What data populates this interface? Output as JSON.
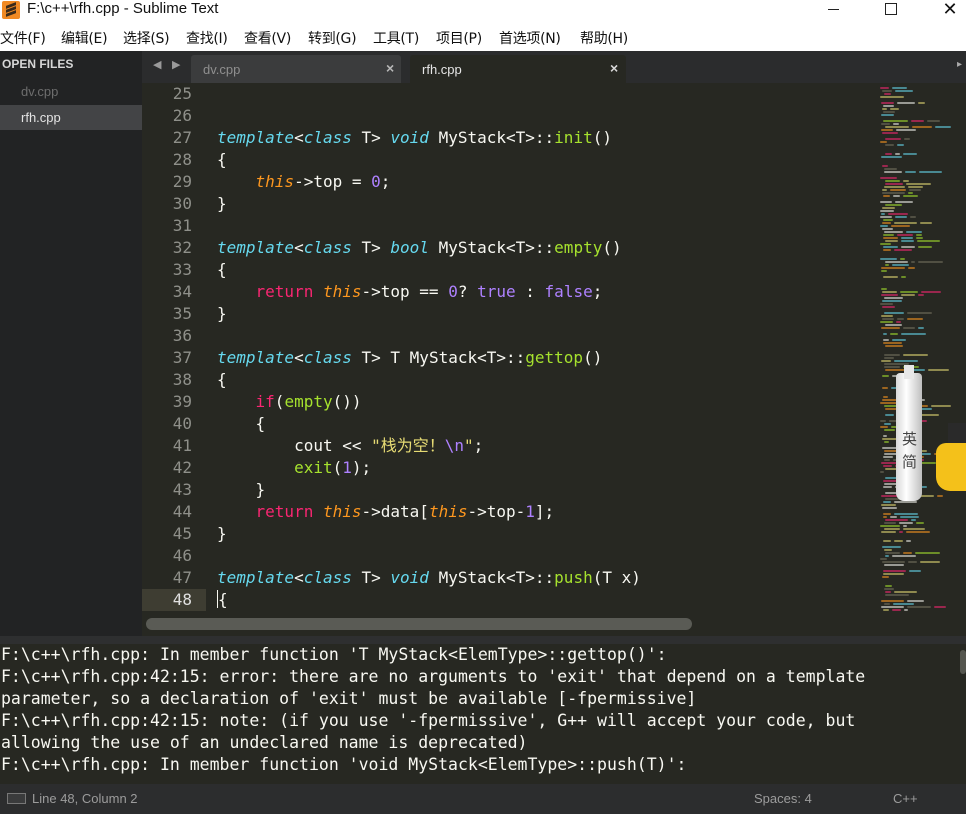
{
  "window": {
    "title": "F:\\c++\\rfh.cpp - Sublime Text",
    "icon": "sublime-text-icon"
  },
  "menu": [
    "文件(F)",
    "编辑(E)",
    "选择(S)",
    "查找(I)",
    "查看(V)",
    "转到(G)",
    "工具(T)",
    "项目(P)",
    "首选项(N)",
    "帮助(H)"
  ],
  "sidebar": {
    "header": "OPEN FILES",
    "files": [
      "dv.cpp",
      "rfh.cpp"
    ],
    "active": "rfh.cpp"
  },
  "tabs": [
    {
      "label": "dv.cpp",
      "close": "×"
    },
    {
      "label": "rfh.cpp",
      "close": "×"
    }
  ],
  "tab_nav": {
    "prev": "◀",
    "next": "▶"
  },
  "editor": {
    "current_line": 48,
    "line_numbers": [
      "25",
      "26",
      "27",
      "28",
      "29",
      "30",
      "31",
      "32",
      "33",
      "34",
      "35",
      "36",
      "37",
      "38",
      "39",
      "40",
      "41",
      "42",
      "43",
      "44",
      "45",
      "46",
      "47",
      "48"
    ],
    "code": [
      {
        "n": "25",
        "t": ""
      },
      {
        "n": "26",
        "t": ""
      },
      {
        "n": "27",
        "t": "template<class T> void MyStack<T>::init()"
      },
      {
        "n": "28",
        "t": "{"
      },
      {
        "n": "29",
        "t": "    this->top = 0;"
      },
      {
        "n": "30",
        "t": "}"
      },
      {
        "n": "31",
        "t": ""
      },
      {
        "n": "32",
        "t": "template<class T> bool MyStack<T>::empty()"
      },
      {
        "n": "33",
        "t": "{"
      },
      {
        "n": "34",
        "t": "    return this->top == 0? true : false;"
      },
      {
        "n": "35",
        "t": "}"
      },
      {
        "n": "36",
        "t": ""
      },
      {
        "n": "37",
        "t": "template<class T> T MyStack<T>::gettop()"
      },
      {
        "n": "38",
        "t": "{"
      },
      {
        "n": "39",
        "t": "    if(empty())"
      },
      {
        "n": "40",
        "t": "    {"
      },
      {
        "n": "41",
        "t": "        cout << \"栈为空！\\n\";"
      },
      {
        "n": "42",
        "t": "        exit(1);"
      },
      {
        "n": "43",
        "t": "    }"
      },
      {
        "n": "44",
        "t": "    return this->data[this->top-1];"
      },
      {
        "n": "45",
        "t": "}"
      },
      {
        "n": "46",
        "t": ""
      },
      {
        "n": "47",
        "t": "template<class T> void MyStack<T>::push(T x)"
      },
      {
        "n": "48",
        "t": "{"
      }
    ],
    "mascot_text": [
      "英",
      "简"
    ]
  },
  "output": [
    "F:\\c++\\rfh.cpp: In member function 'T MyStack<ElemType>::gettop()':",
    "F:\\c++\\rfh.cpp:42:15: error: there are no arguments to 'exit' that depend on a template",
    "parameter, so a declaration of 'exit' must be available [-fpermissive]",
    "F:\\c++\\rfh.cpp:42:15: note: (if you use '-fpermissive', G++ will accept your code, but",
    "allowing the use of an undeclared name is deprecated)",
    "F:\\c++\\rfh.cpp: In member function 'void MyStack<ElemType>::push(T)':"
  ],
  "status": {
    "position": "Line 48, Column 2",
    "spaces": "Spaces: 4",
    "syntax": "C++"
  },
  "colors": {
    "editor_bg": "#272822",
    "keyword_italic": "#66d9ef",
    "keyword": "#f92672",
    "function": "#a6e22e",
    "this": "#fd971f",
    "number": "#ae81ff",
    "string": "#e6db74",
    "sidebar_bg": "#222324",
    "brand": "#f08a24"
  }
}
